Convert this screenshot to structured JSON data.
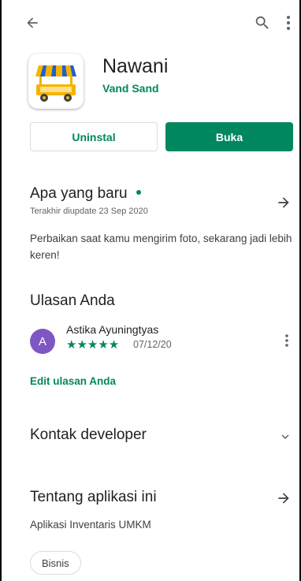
{
  "app": {
    "name": "Nawani",
    "developer": "Vand Sand"
  },
  "actions": {
    "uninstall_label": "Uninstal",
    "open_label": "Buka"
  },
  "whats_new": {
    "title": "Apa yang baru",
    "updated": "Terakhir diupdate 23 Sep 2020",
    "text": "Perbaikan saat kamu mengirim foto, sekarang jadi lebih keren!"
  },
  "review": {
    "title": "Ulasan Anda",
    "avatar_letter": "A",
    "reviewer": "Astika Ayuningtyas",
    "stars": "★★★★★",
    "rating": 5,
    "date": "07/12/20",
    "edit_label": "Edit ulasan Anda"
  },
  "developer_contact": {
    "title": "Kontak developer"
  },
  "about": {
    "title": "Tentang aplikasi ini",
    "text": "Aplikasi Inventaris UMKM",
    "category": "Bisnis"
  },
  "icons": {
    "back": "arrow-left-icon",
    "search": "search-icon",
    "more": "more-vert-icon",
    "forward": "arrow-right-icon",
    "expand": "chevron-down-icon"
  },
  "colors": {
    "accent": "#01875f",
    "avatar": "#7e57c2"
  }
}
